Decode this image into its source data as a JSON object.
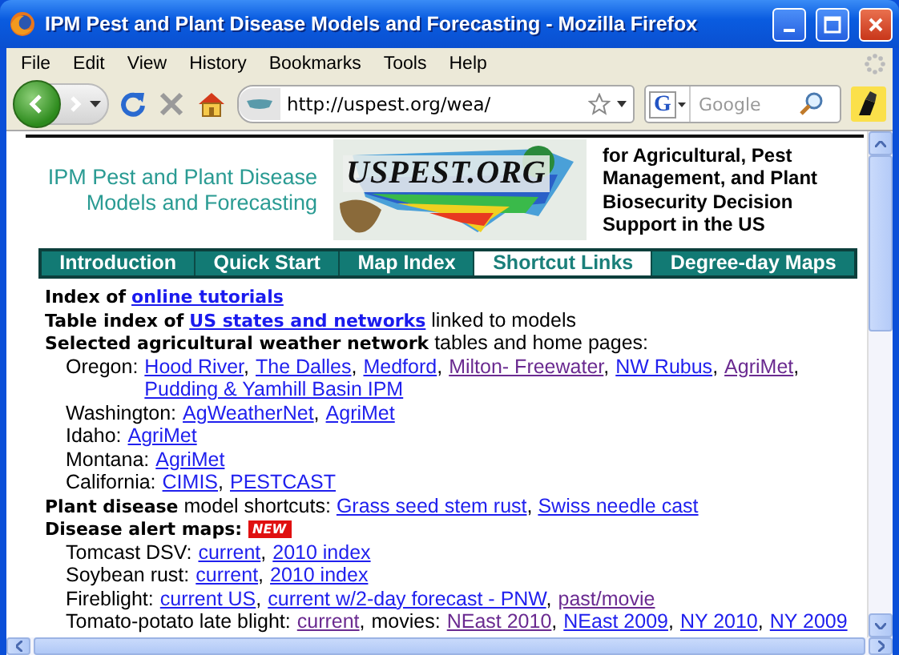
{
  "window": {
    "title": "IPM Pest and Plant Disease Models and Forecasting - Mozilla Firefox"
  },
  "menu": [
    "File",
    "Edit",
    "View",
    "History",
    "Bookmarks",
    "Tools",
    "Help"
  ],
  "toolbar": {
    "url": "http://uspest.org/wea/",
    "search_engine": "G",
    "search_placeholder": "Google"
  },
  "header": {
    "title": "IPM Pest and Plant Disease Models and Forecasting",
    "logo": "USPEST.ORG",
    "tagline": "for Agricultural, Pest Management, and Plant Biosecurity Decision Support in the US"
  },
  "tabs": [
    {
      "label": "Introduction",
      "selected": false
    },
    {
      "label": "Quick Start",
      "selected": false
    },
    {
      "label": "Map Index",
      "selected": false
    },
    {
      "label": "Shortcut Links",
      "selected": true
    },
    {
      "label": "Degree-day Maps",
      "selected": false
    }
  ],
  "body": [
    {
      "parts": [
        {
          "kind": "bold",
          "text": "Index of"
        },
        {
          "kind": "link",
          "text": "online tutorials",
          "bold": true,
          "visited": false
        }
      ]
    },
    {
      "parts": [
        {
          "kind": "bold",
          "text": "Table index of"
        },
        {
          "kind": "link",
          "text": "US states and networks",
          "bold": true,
          "visited": false
        },
        {
          "kind": "text",
          "text": "linked to models"
        }
      ]
    },
    {
      "parts": [
        {
          "kind": "bold",
          "text": "Selected agricultural weather network"
        },
        {
          "kind": "text",
          "text": "tables and home pages:"
        }
      ],
      "children": [
        {
          "label": "Oregon:",
          "parts": [
            {
              "kind": "link",
              "text": "Hood River",
              "visited": false,
              "suffix": ","
            },
            {
              "kind": "link",
              "text": "The Dalles",
              "visited": false,
              "suffix": ","
            },
            {
              "kind": "link",
              "text": "Medford",
              "visited": false,
              "suffix": ","
            },
            {
              "kind": "link",
              "text": "Milton- Freewater",
              "visited": true,
              "suffix": ","
            },
            {
              "kind": "link",
              "text": "NW Rubus",
              "visited": false,
              "suffix": ","
            },
            {
              "kind": "link",
              "text": "AgriMet",
              "visited": true,
              "suffix": ","
            },
            {
              "kind": "link",
              "text": "Pudding & Yamhill Basin IPM",
              "visited": false
            }
          ]
        },
        {
          "label": "Washington:",
          "parts": [
            {
              "kind": "link",
              "text": "AgWeatherNet",
              "visited": false,
              "suffix": ","
            },
            {
              "kind": "link",
              "text": "AgriMet",
              "visited": false
            }
          ]
        },
        {
          "label": "Idaho:",
          "parts": [
            {
              "kind": "link",
              "text": "AgriMet",
              "visited": false
            }
          ]
        },
        {
          "label": "Montana:",
          "parts": [
            {
              "kind": "link",
              "text": "AgriMet",
              "visited": false
            }
          ]
        },
        {
          "label": "California:",
          "parts": [
            {
              "kind": "link",
              "text": "CIMIS",
              "visited": false,
              "suffix": ","
            },
            {
              "kind": "link",
              "text": "PESTCAST",
              "visited": false
            }
          ]
        }
      ]
    },
    {
      "parts": [
        {
          "kind": "bold",
          "text": "Plant disease"
        },
        {
          "kind": "text",
          "text": "model shortcuts:"
        },
        {
          "kind": "link",
          "text": "Grass seed stem rust",
          "visited": false,
          "suffix": ","
        },
        {
          "kind": "link",
          "text": "Swiss needle cast",
          "visited": false
        }
      ]
    },
    {
      "parts": [
        {
          "kind": "bold",
          "text": "Disease alert maps:"
        },
        {
          "kind": "badge",
          "text": "NEW"
        }
      ],
      "children": [
        {
          "label": "Tomcast DSV:",
          "parts": [
            {
              "kind": "link",
              "text": "current",
              "visited": false,
              "suffix": ","
            },
            {
              "kind": "link",
              "text": "2010 index",
              "visited": false
            }
          ]
        },
        {
          "label": "Soybean rust:",
          "parts": [
            {
              "kind": "link",
              "text": "current",
              "visited": false,
              "suffix": ","
            },
            {
              "kind": "link",
              "text": "2010 index",
              "visited": false
            }
          ]
        },
        {
          "label": "Fireblight:",
          "parts": [
            {
              "kind": "link",
              "text": "current US",
              "visited": false,
              "suffix": ","
            },
            {
              "kind": "link",
              "text": "current w/2-day forecast - PNW",
              "visited": false,
              "suffix": ","
            },
            {
              "kind": "link",
              "text": "past/movie",
              "visited": true
            }
          ]
        },
        {
          "label": "Tomato-potato late blight:",
          "parts": [
            {
              "kind": "link",
              "text": "current",
              "visited": true,
              "suffix": ","
            },
            {
              "kind": "text",
              "text": "movies:"
            },
            {
              "kind": "link",
              "text": "NEast 2010",
              "visited": true,
              "suffix": ","
            },
            {
              "kind": "link",
              "text": "NEast 2009",
              "visited": false,
              "suffix": ","
            },
            {
              "kind": "link",
              "text": "NY 2010",
              "visited": false,
              "suffix": ","
            },
            {
              "kind": "link",
              "text": "NY 2009",
              "visited": false
            }
          ]
        }
      ]
    }
  ]
}
